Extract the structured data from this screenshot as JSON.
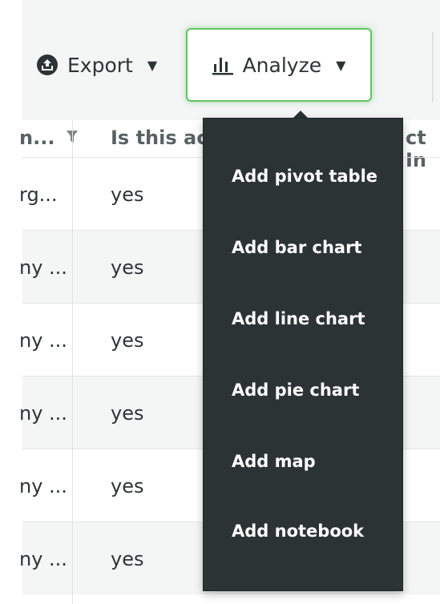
{
  "toolbar": {
    "export_label": "Export",
    "analyze_label": "Analyze",
    "dropdown_caret": "▼"
  },
  "table": {
    "headers": {
      "col1": "n...",
      "col2": "Is this ac",
      "col3": "ct In"
    },
    "rows": [
      {
        "col1": "rg...",
        "col2": "yes"
      },
      {
        "col1": "ny ...",
        "col2": "yes"
      },
      {
        "col1": "ny ...",
        "col2": "yes"
      },
      {
        "col1": "ny ...",
        "col2": "yes"
      },
      {
        "col1": "ny ...",
        "col2": "yes"
      },
      {
        "col1": "ny ...",
        "col2": "yes"
      }
    ]
  },
  "analyze_menu": {
    "items": [
      "Add pivot table",
      "Add bar chart",
      "Add line chart",
      "Add pie chart",
      "Add map",
      "Add notebook"
    ]
  },
  "colors": {
    "accent_green": "#62c563",
    "menu_bg": "#2c3335",
    "row_shade": "#f4f5f5"
  },
  "icons": {
    "export": "upload-circle-icon",
    "analyze": "bar-chart-icon",
    "filter": "filter-funnel-icon"
  }
}
